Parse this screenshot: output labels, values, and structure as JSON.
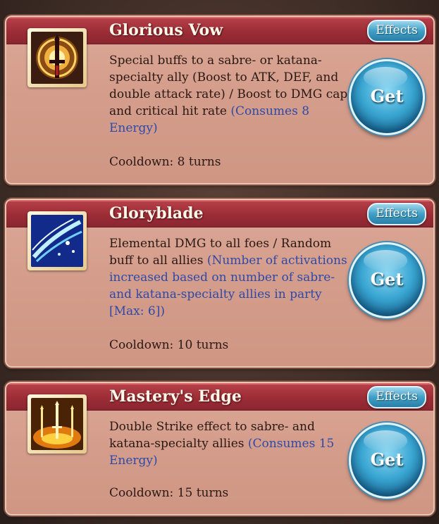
{
  "cards": [
    {
      "name": "Glorious Vow",
      "effects_label": "Effects",
      "description": "Special buffs to a sabre- or katana-specialty ally (Boost to ATK, DEF, and double attack rate) / Boost to DMG cap and critical hit rate",
      "highlight": "(Consumes 8 Energy)",
      "cooldown": "Cooldown: 8 turns",
      "get_label": "Get",
      "icon": "sword-sigil-icon"
    },
    {
      "name": "Gloryblade",
      "effects_label": "Effects",
      "description": "Elemental DMG to all foes / Random buff to all allies",
      "highlight": "(Number of activations increased based on number of sabre- and katana-specialty allies in party [Max: 6])",
      "cooldown": "Cooldown: 10 turns",
      "get_label": "Get",
      "icon": "blade-slash-icon"
    },
    {
      "name": "Mastery's Edge",
      "effects_label": "Effects",
      "description": "Double Strike effect to sabre- and katana-specialty allies",
      "highlight": "(Consumes 15 Energy)",
      "cooldown": "Cooldown: 15 turns",
      "get_label": "Get",
      "icon": "golden-swords-icon"
    }
  ],
  "colors": {
    "header_red": "#9c2d36",
    "card_bg": "#d49c8a",
    "highlight_blue": "#2d4aa8",
    "button_blue": "#3aa6d2"
  }
}
